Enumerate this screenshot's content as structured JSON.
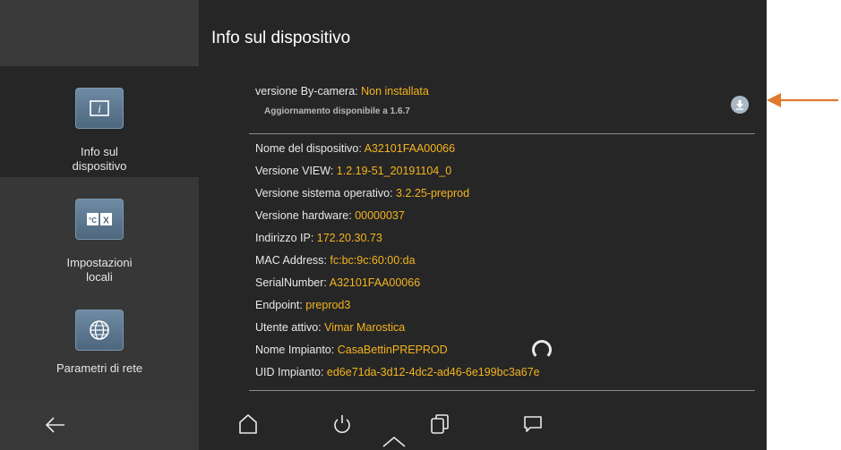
{
  "header": {
    "title": "Info sul dispositivo"
  },
  "sidebar": {
    "items": [
      {
        "label": "Info sul\ndispositivo",
        "icon": "info-icon",
        "active": true
      },
      {
        "label": "Impostazioni\nlocali",
        "icon": "temperature-settings-icon",
        "active": false
      },
      {
        "label": "Parametri di rete",
        "icon": "globe-icon",
        "active": false
      }
    ]
  },
  "bycamera": {
    "label": "versione By-camera: ",
    "value": "Non installata",
    "update_note": "Aggiornamento disponibile a 1.6.7",
    "update_icon": "download-icon"
  },
  "info": [
    {
      "label": "Nome del dispositivo: ",
      "value": "A32101FAA00066"
    },
    {
      "label": "Versione VIEW: ",
      "value": "1.2.19-51_20191104_0"
    },
    {
      "label": "Versione sistema operativo: ",
      "value": "3.2.25-preprod"
    },
    {
      "label": "Versione hardware: ",
      "value": "00000037"
    },
    {
      "label": "Indirizzo IP: ",
      "value": "172.20.30.73"
    },
    {
      "label": "MAC Address: ",
      "value": "fc:bc:9c:60:00:da"
    },
    {
      "label": "SerialNumber: ",
      "value": "A32101FAA00066"
    },
    {
      "label": "Endpoint: ",
      "value": "preprod3"
    },
    {
      "label": "Utente attivo: ",
      "value": "Vimar Marostica"
    },
    {
      "label": "Nome Impianto: ",
      "value": "CasaBettinPREPROD"
    },
    {
      "label": "UID Impianto: ",
      "value": "ed6e71da-3d12-4dc2-ad46-6e199bc3a67e"
    }
  ],
  "bottom_nav": [
    "back-icon",
    "home-icon",
    "power-icon",
    "recent-apps-icon",
    "message-icon",
    "chevron-up-icon"
  ],
  "colors": {
    "accent_value": "#f4b41e",
    "background": "#262626",
    "sidebar": "#373737",
    "arrow": "#e07a2e",
    "icon_tile": "#5d7990"
  }
}
